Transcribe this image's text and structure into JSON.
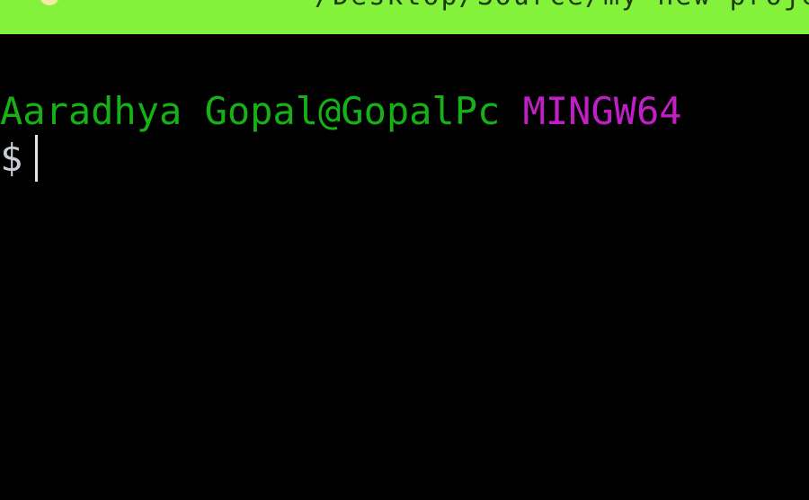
{
  "window": {
    "title": "~/Desktop/Source/my-new-project",
    "titlebar_color": "#84f13a",
    "icon": "bash-icon"
  },
  "terminal": {
    "background": "#000000",
    "prompt": {
      "user_host": "Aaradhya Gopal@GopalPc",
      "system_name": "MINGW64",
      "user_host_color": "#17b016",
      "system_name_color": "#c21ec7"
    },
    "input_symbol": "$",
    "input_text": ""
  }
}
